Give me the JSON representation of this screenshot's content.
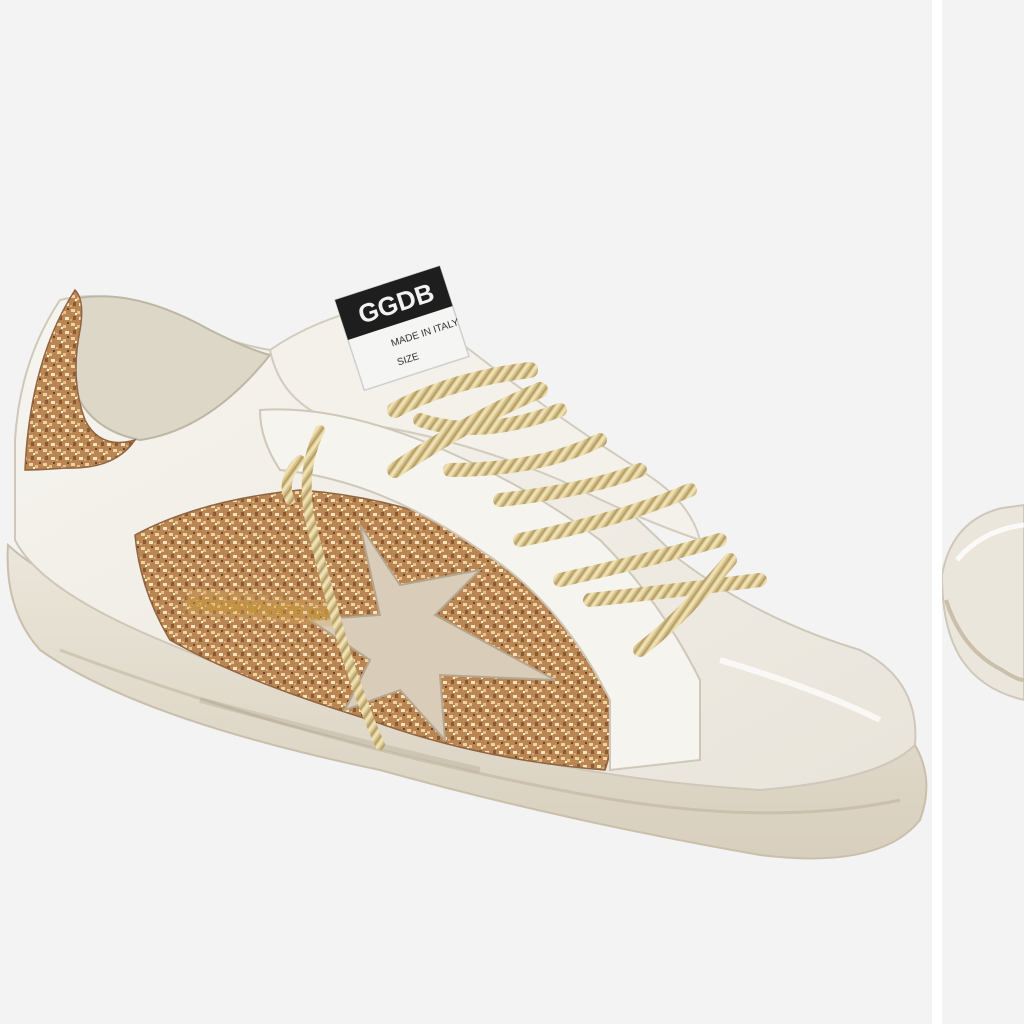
{
  "product": {
    "tag_brand": "GGDB",
    "tag_line1": "MADE IN ITALY",
    "tag_line2": "SIZE",
    "side_stamp": "GGDBPRIVATE 0H"
  },
  "colors": {
    "background": "#f3f3f3",
    "leather": "#f1ede5",
    "glitter": "#c99a66",
    "star_suede": "#d8cbb8",
    "sole": "#e2dbcc",
    "laces": "#d9c48f"
  }
}
